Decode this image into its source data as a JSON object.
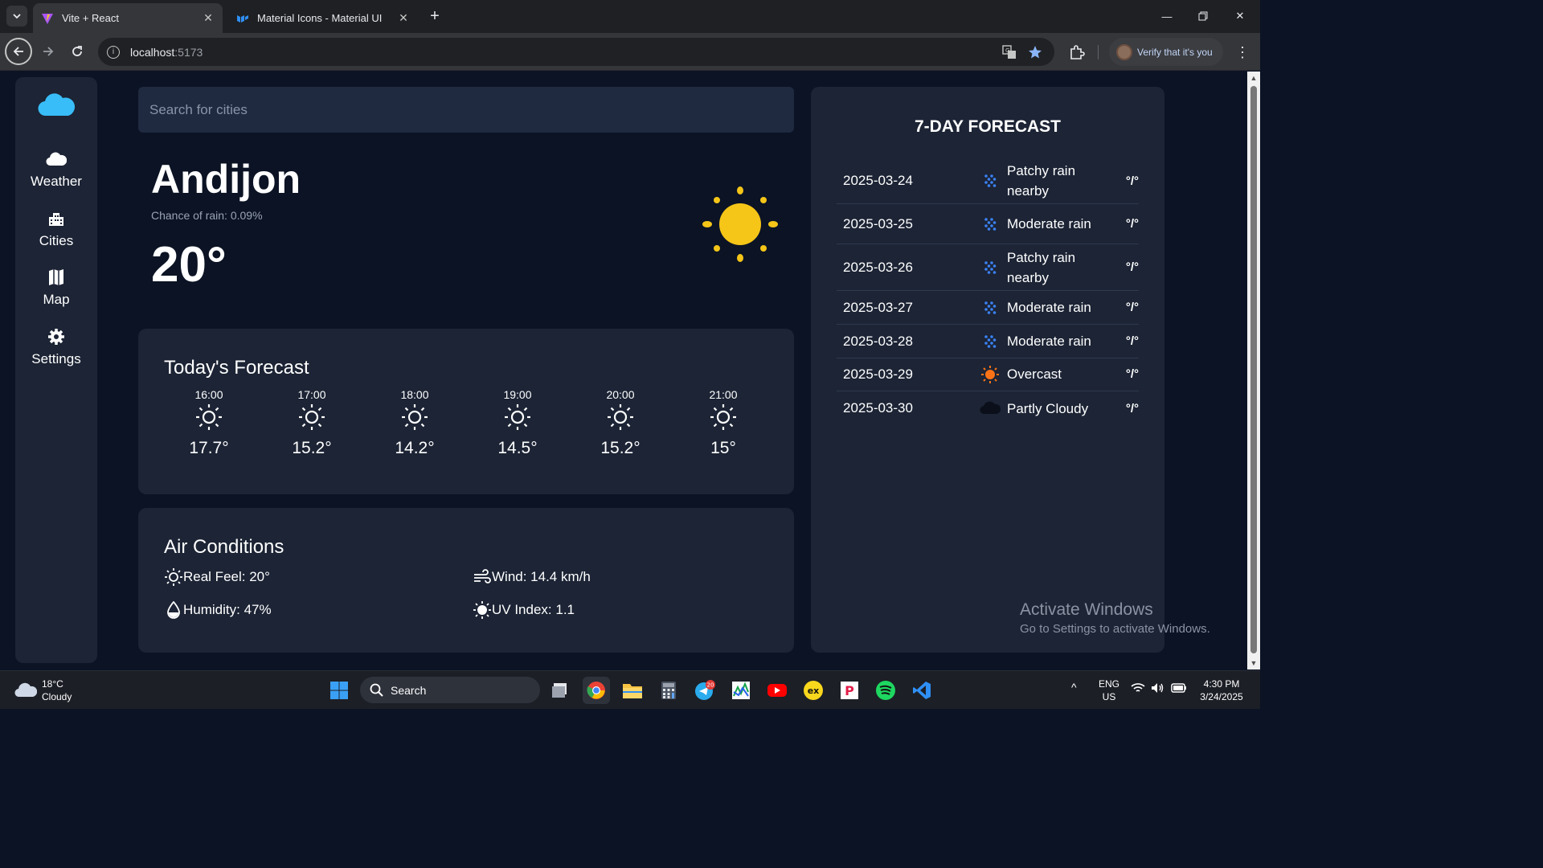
{
  "browser": {
    "tabs": [
      {
        "title": "Vite + React",
        "active": true
      },
      {
        "title": "Material Icons - Material UI",
        "active": false
      }
    ],
    "url_host": "localhost",
    "url_port": ":5173",
    "profile_label": "Verify that it's you"
  },
  "search": {
    "placeholder": "Search for cities"
  },
  "sidebar": {
    "items": [
      {
        "label": "Weather",
        "icon": "cloud-icon"
      },
      {
        "label": "Cities",
        "icon": "cities-icon"
      },
      {
        "label": "Map",
        "icon": "map-icon"
      },
      {
        "label": "Settings",
        "icon": "gear-icon"
      }
    ]
  },
  "current": {
    "city": "Andijon",
    "rain_chance": "Chance of rain: 0.09%",
    "temperature": "20°",
    "icon": "sun-icon"
  },
  "today": {
    "title": "Today's Forecast",
    "hours": [
      {
        "time": "16:00",
        "temp": "17.7°"
      },
      {
        "time": "17:00",
        "temp": "15.2°"
      },
      {
        "time": "18:00",
        "temp": "14.2°"
      },
      {
        "time": "19:00",
        "temp": "14.5°"
      },
      {
        "time": "20:00",
        "temp": "15.2°"
      },
      {
        "time": "21:00",
        "temp": "15°"
      }
    ]
  },
  "air": {
    "title": "Air Conditions",
    "real_feel": "Real Feel: 20°",
    "wind": "Wind: 14.4 km/h",
    "humidity": "Humidity: 47%",
    "uv": "UV Index: 1.1"
  },
  "forecast": {
    "title": "7-DAY FORECAST",
    "days": [
      {
        "date": "2025-03-24",
        "condition": "Patchy rain nearby",
        "icon": "rain-icon",
        "deg": "°/°"
      },
      {
        "date": "2025-03-25",
        "condition": "Moderate rain",
        "icon": "rain-icon",
        "deg": "°/°"
      },
      {
        "date": "2025-03-26",
        "condition": "Patchy rain nearby",
        "icon": "rain-icon",
        "deg": "°/°"
      },
      {
        "date": "2025-03-27",
        "condition": "Moderate rain",
        "icon": "rain-icon",
        "deg": "°/°"
      },
      {
        "date": "2025-03-28",
        "condition": "Moderate rain",
        "icon": "rain-icon",
        "deg": "°/°"
      },
      {
        "date": "2025-03-29",
        "condition": "Overcast",
        "icon": "sun-orange-icon",
        "deg": "°/°"
      },
      {
        "date": "2025-03-30",
        "condition": "Partly Cloudy",
        "icon": "dark-cloud-icon",
        "deg": "°/°"
      }
    ]
  },
  "watermark": {
    "heading": "Activate Windows",
    "sub": "Go to Settings to activate Windows."
  },
  "taskbar": {
    "weather_temp": "18°C",
    "weather_desc": "Cloudy",
    "search_label": "Search",
    "telegram_badge": "20",
    "lang_top": "ENG",
    "lang_bottom": "US",
    "time": "4:30 PM",
    "date": "3/24/2025"
  },
  "colors": {
    "page_bg": "#0b1324",
    "card_bg": "#1c2435",
    "sun": "#f5c518",
    "rain_icon": "#3b82f6"
  }
}
